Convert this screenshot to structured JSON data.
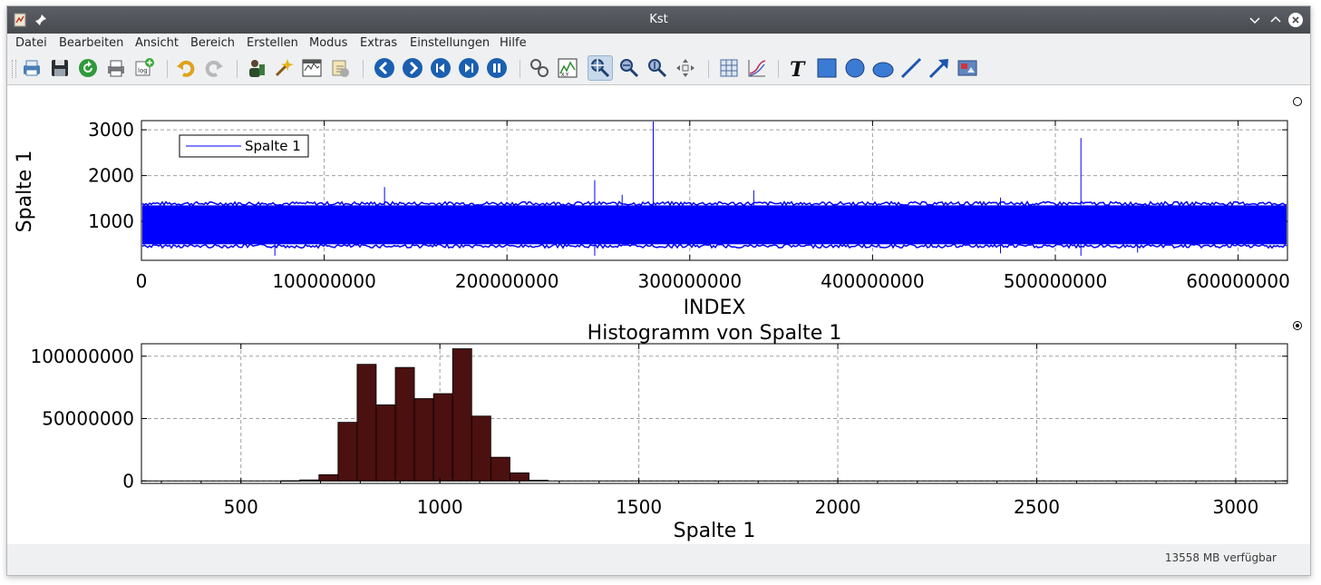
{
  "window": {
    "title": "Kst"
  },
  "menu": [
    "Datei",
    "Bearbeiten",
    "Ansicht",
    "Bereich",
    "Erstellen",
    "Modus",
    "Extras",
    "Einstellungen",
    "Hilfe"
  ],
  "status": {
    "memory": "13558 MB verfügbar"
  },
  "colors": {
    "curve": "#0000ff",
    "histogram_fill": "#4b1010",
    "grid": "#a0a0a0"
  },
  "toolbar_icons": [
    "print-icon",
    "save-icon",
    "reload-icon",
    "printer-icon",
    "export-log-icon",
    "undo-icon",
    "redo-icon",
    "data-manager-icon",
    "data-wizard-icon",
    "change-data-file-icon",
    "change-data-sample-icon",
    "back-icon",
    "forward-icon",
    "back-to-start-icon",
    "forward-to-end-icon",
    "pause-icon",
    "tied-zoom-icon",
    "zoom-xy-icon",
    "xy-zoom-mode-icon",
    "x-zoom-mode-icon",
    "y-zoom-mode-icon",
    "layout-mode-icon",
    "create-plot-icon",
    "create-curve-icon",
    "text-icon",
    "box-icon",
    "circle-icon",
    "ellipse-icon",
    "line-icon",
    "arrow-icon",
    "picture-icon"
  ],
  "chart_data": [
    {
      "type": "line",
      "title": "",
      "xlabel": "INDEX",
      "ylabel": "Spalte 1",
      "xlim": [
        0,
        627000000
      ],
      "ylim": [
        150,
        3200
      ],
      "xticks": [
        0,
        100000000,
        200000000,
        300000000,
        400000000,
        500000000,
        600000000
      ],
      "xtick_labels": [
        "0",
        "100000000",
        "200000000",
        "300000000",
        "400000000",
        "500000000",
        "600000000"
      ],
      "yticks": [
        1000,
        2000,
        3000
      ],
      "ytick_labels": [
        "1000",
        "2000",
        "3000"
      ],
      "grid": true,
      "legend": {
        "placement": "top-left",
        "entries": [
          "Spalte 1"
        ]
      },
      "series": [
        {
          "name": "Spalte 1",
          "band": {
            "low": 500,
            "high": 1350
          },
          "spikes": [
            {
              "x": 73000000,
              "y": 250
            },
            {
              "x": 133000000,
              "y": 1750
            },
            {
              "x": 248000000,
              "y": 1900
            },
            {
              "x": 248000000,
              "y": 250
            },
            {
              "x": 263000000,
              "y": 1580
            },
            {
              "x": 280000000,
              "y": 3180
            },
            {
              "x": 335000000,
              "y": 1680
            },
            {
              "x": 470000000,
              "y": 1520
            },
            {
              "x": 470000000,
              "y": 300
            },
            {
              "x": 514000000,
              "y": 2820
            },
            {
              "x": 514000000,
              "y": 250
            },
            {
              "x": 545000000,
              "y": 320
            }
          ]
        }
      ]
    },
    {
      "type": "bar",
      "title": "Histogramm von Spalte 1",
      "xlabel": "Spalte 1",
      "ylabel": "",
      "xlim": [
        250,
        3130
      ],
      "ylim": [
        -2000000,
        110000000
      ],
      "xticks": [
        500,
        1000,
        1500,
        2000,
        2500,
        3000
      ],
      "xtick_labels": [
        "500",
        "1000",
        "1500",
        "2000",
        "2500",
        "3000"
      ],
      "yticks": [
        0,
        50000000,
        100000000
      ],
      "ytick_labels": [
        "0",
        "50000000",
        "100000000"
      ],
      "grid": true,
      "bin_width": 48,
      "bins_start": [
        600,
        648,
        696,
        744,
        792,
        840,
        888,
        936,
        984,
        1032,
        1080,
        1128,
        1176,
        1224
      ],
      "values": [
        100000,
        800000,
        5000000,
        47000000,
        93500000,
        61000000,
        91000000,
        66000000,
        70000000,
        106000000,
        52000000,
        19000000,
        6500000,
        600000
      ]
    }
  ]
}
